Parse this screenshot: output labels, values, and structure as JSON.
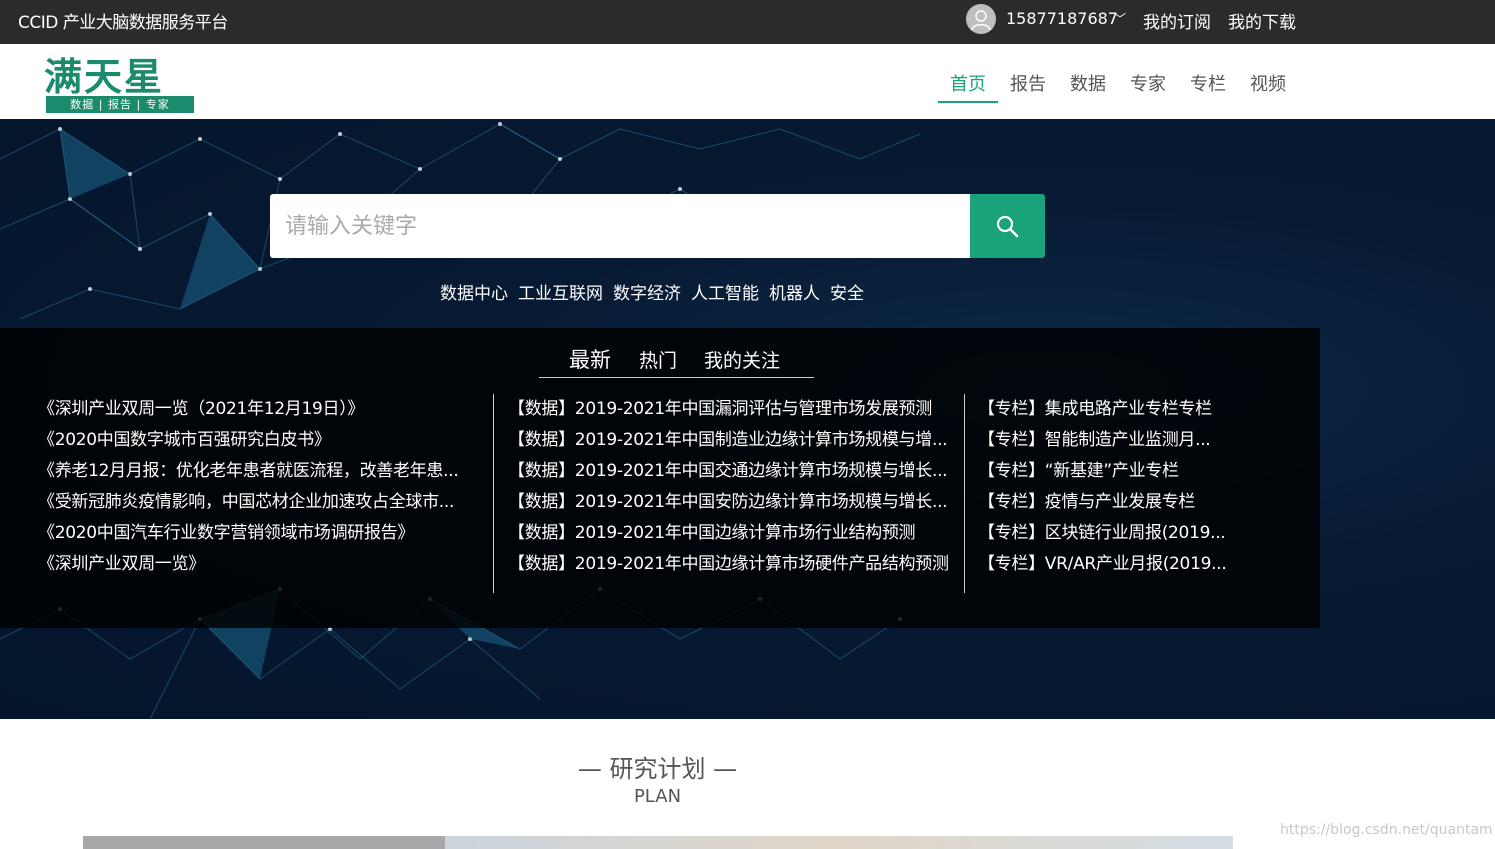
{
  "topbar": {
    "site_title": "CCID 产业大脑数据服务平台",
    "phone": "15877187687",
    "chevron": "﹀",
    "subscribe": "我的订阅",
    "download": "我的下载"
  },
  "header": {
    "logo_text": "满天星",
    "logo_tagline": "数据 | 报告 | 专家",
    "nav": [
      "首页",
      "报告",
      "数据",
      "专家",
      "专栏",
      "视频"
    ],
    "active_nav": "首页"
  },
  "search": {
    "placeholder": "请输入关键字",
    "hot_tags": [
      "数据中心",
      "工业互联网",
      "数字经济",
      "人工智能",
      "机器人",
      "安全"
    ]
  },
  "panel": {
    "tabs": [
      "最新",
      "热门",
      "我的关注"
    ],
    "col1": [
      "《深圳产业双周一览（2021年12月19日）》",
      "《2020中国数字城市百强研究白皮书》",
      "《养老12月月报：优化老年患者就医流程，改善老年患...",
      "《受新冠肺炎疫情影响，中国芯材企业加速攻占全球市...",
      "《2020中国汽车行业数字营销领域市场调研报告》",
      "《深圳产业双周一览》"
    ],
    "col2": [
      "【数据】2019-2021年中国漏洞评估与管理市场发展预测",
      "【数据】2019-2021年中国制造业边缘计算市场规模与增...",
      "【数据】2019-2021年中国交通边缘计算市场规模与增长...",
      "【数据】2019-2021年中国安防边缘计算市场规模与增长...",
      "【数据】2019-2021年中国边缘计算市场行业结构预测",
      "【数据】2019-2021年中国边缘计算市场硬件产品结构预测"
    ],
    "col3": [
      "【专栏】集成电路产业专栏专栏",
      "【专栏】智能制造产业监测月...",
      "【专栏】“新基建”产业专栏",
      "【专栏】疫情与产业发展专栏",
      "【专栏】区块链行业周报(2019...",
      "【专栏】VR/AR产业月报(2019..."
    ]
  },
  "plan": {
    "title": "— 研究计划 —",
    "subtitle": "PLAN"
  },
  "watermark": "https://blog.csdn.net/quantam",
  "colors": {
    "accent": "#1aa37a",
    "topbar": "#2b2b2b",
    "logo": "#1c8a6d"
  }
}
